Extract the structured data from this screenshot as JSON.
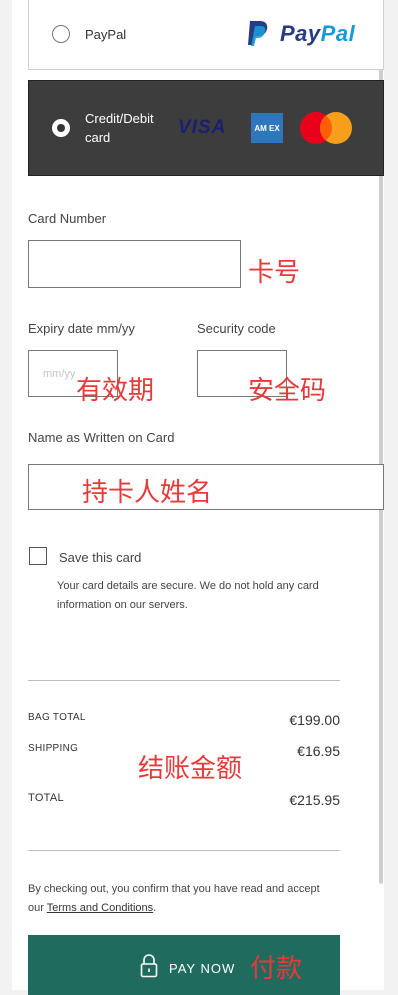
{
  "payment": {
    "paypal": {
      "label": "PayPal",
      "logo_pay": "Pay",
      "logo_pal": "Pal"
    },
    "card": {
      "label_line1": "Credit/Debit",
      "label_line2": "card",
      "visa": "VISA",
      "amex": "AM EX"
    }
  },
  "form": {
    "card_number_label": "Card Number",
    "card_number_annotation": "卡号",
    "expiry_label": "Expiry date mm/yy",
    "expiry_placeholder": "mm/yy",
    "expiry_annotation": "有效期",
    "security_label": "Security code",
    "security_annotation": "安全码",
    "name_label": "Name as Written on Card",
    "name_annotation": "持卡人姓名"
  },
  "save_card": {
    "label": "Save this card",
    "note_line1": "Your card details are secure. We do not hold any card",
    "note_line2": "information on our servers."
  },
  "summary": {
    "annotation": "结账金额",
    "bag_total_label": "BAG TOTAL",
    "bag_total_value": "€199.00",
    "shipping_label": "SHIPPING",
    "shipping_value": "€16.95",
    "total_label": "TOTAL",
    "total_value": "€215.95"
  },
  "terms": {
    "line1": "By checking out, you confirm that you have read and accept",
    "prefix": "our ",
    "link": "Terms and Conditions",
    "suffix": "."
  },
  "pay_button": {
    "label": "PAY NOW",
    "annotation": "付款"
  },
  "colors": {
    "pay_button": "#1f6b5e",
    "selected_card_bg": "#3d3d3d",
    "annotation_red": "#e8393a"
  }
}
